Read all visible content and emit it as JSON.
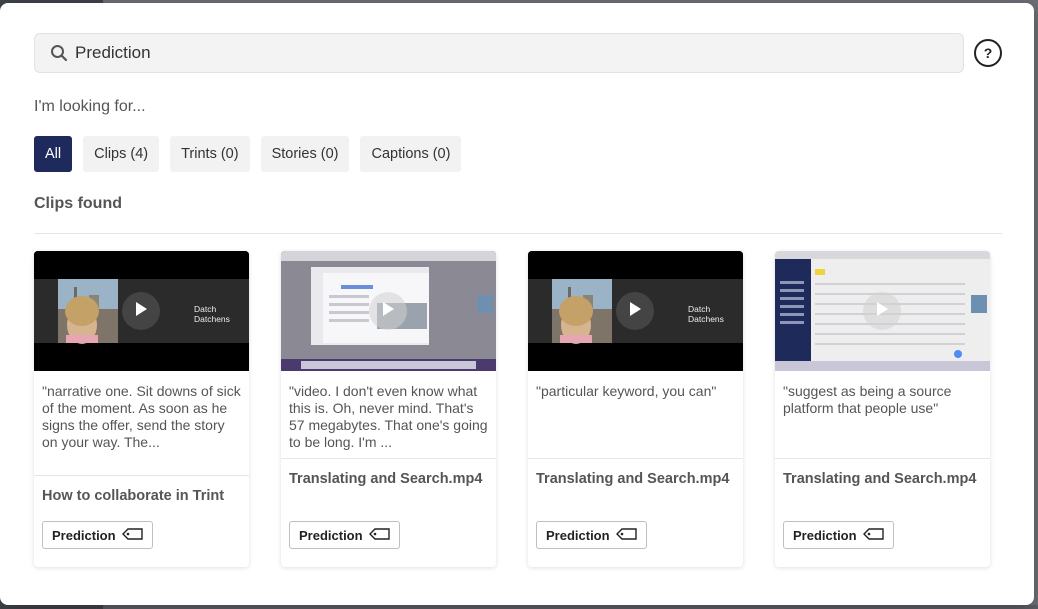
{
  "search": {
    "value": "Prediction"
  },
  "help": {
    "label": "?"
  },
  "looking_for": "I'm looking for...",
  "filters": [
    {
      "label": "All",
      "active": true
    },
    {
      "label": "Clips (4)",
      "active": false
    },
    {
      "label": "Trints (0)",
      "active": false
    },
    {
      "label": "Stories (0)",
      "active": false
    },
    {
      "label": "Captions (0)",
      "active": false
    }
  ],
  "section_title": "Clips found",
  "clips": [
    {
      "thumb": "video",
      "thumb_caption": "Datch Datchens",
      "quote": "\"narrative one. Sit downs of sick of the moment. As soon as he signs the offer, send the story on your way. The...",
      "title": "How to collaborate in Trint",
      "tag": "Prediction"
    },
    {
      "thumb": "screen",
      "thumb_caption": "",
      "quote": "\"video. I don't even know what this is. Oh, never mind. That's 57 megabytes. That one's going to be long. I'm ...",
      "title": "Translating and Search.mp4",
      "tag": "Prediction"
    },
    {
      "thumb": "video",
      "thumb_caption": "Datch Datchens",
      "quote": "\"particular keyword, you can\"",
      "title": "Translating and Search.mp4",
      "tag": "Prediction"
    },
    {
      "thumb": "app",
      "thumb_caption": "",
      "quote": "\"suggest as being a source platform that people use\"",
      "title": "Translating and Search.mp4",
      "tag": "Prediction"
    }
  ],
  "colors": {
    "accent": "#1f2a5c",
    "filter_bg": "#f2f2f2",
    "text_muted": "#555555"
  },
  "icons": {
    "search": "search-icon",
    "help": "help-icon",
    "play": "play-icon",
    "tag": "tag-icon"
  }
}
